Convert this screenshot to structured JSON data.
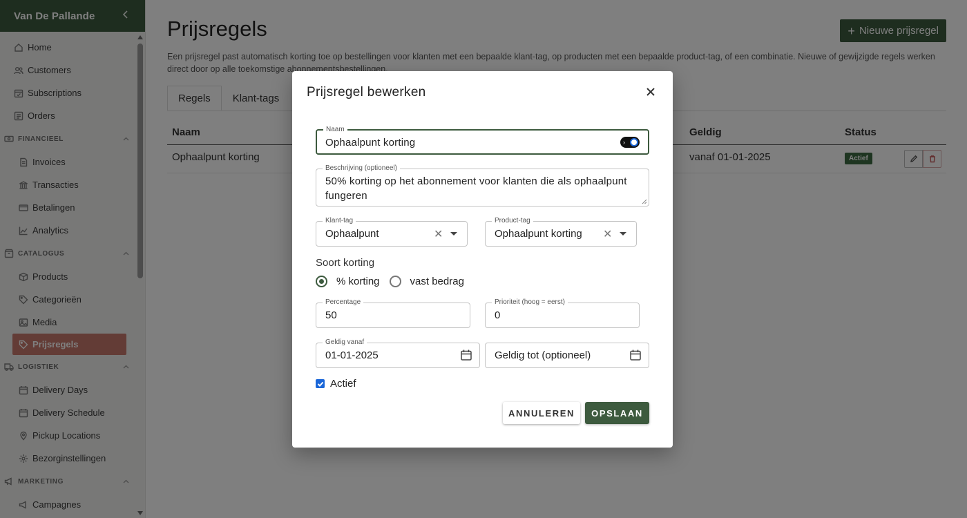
{
  "sidebar": {
    "brand": "Van De Pallande",
    "items_top": [
      {
        "label": "Home",
        "icon": "home-icon"
      },
      {
        "label": "Customers",
        "icon": "users-icon"
      },
      {
        "label": "Subscriptions",
        "icon": "calendar-check-icon"
      },
      {
        "label": "Orders",
        "icon": "list-icon"
      }
    ],
    "sections": [
      {
        "title": "FINANCIEEL",
        "icon": "money-icon",
        "items": [
          {
            "label": "Invoices",
            "icon": "document-icon"
          },
          {
            "label": "Transacties",
            "icon": "bank-icon"
          },
          {
            "label": "Betalingen",
            "icon": "credit-card-icon"
          },
          {
            "label": "Analytics",
            "icon": "chart-line-icon"
          }
        ]
      },
      {
        "title": "CATALOGUS",
        "icon": "box-icon",
        "items": [
          {
            "label": "Products",
            "icon": "cube-icon"
          },
          {
            "label": "Categorieën",
            "icon": "tag-icon"
          },
          {
            "label": "Media",
            "icon": "image-icon"
          },
          {
            "label": "Prijsregels",
            "icon": "tag-icon",
            "active": true
          }
        ]
      },
      {
        "title": "LOGISTIEK",
        "icon": "truck-icon",
        "items": [
          {
            "label": "Delivery Days",
            "icon": "calendar-icon"
          },
          {
            "label": "Delivery Schedule",
            "icon": "calendar-icon"
          },
          {
            "label": "Pickup Locations",
            "icon": "map-pin-icon"
          },
          {
            "label": "Bezorginstellingen",
            "icon": "gear-icon"
          }
        ]
      },
      {
        "title": "MARKETING",
        "icon": "megaphone-icon",
        "items": [
          {
            "label": "Campagnes",
            "icon": "megaphone-icon"
          }
        ]
      }
    ]
  },
  "page": {
    "title": "Prijsregels",
    "new_button": "Nieuwe prijsregel",
    "description": "Een prijsregel past automatisch korting toe op bestellingen voor klanten met een bepaalde klant-tag, op producten met een bepaalde product-tag, of een combinatie. Nieuwe of gewijzigde regels werken direct door op alle toekomstige abonnementsbestellingen.",
    "tabs": [
      "Regels",
      "Klant-tags"
    ],
    "table": {
      "columns": {
        "name": "Naam",
        "valid": "Geldig",
        "status": "Status"
      },
      "rows": [
        {
          "name": "Ophaalpunt korting",
          "valid": "vanaf 01-01-2025",
          "status": "Actief"
        }
      ]
    }
  },
  "dialog": {
    "title": "Prijsregel bewerken",
    "name_label": "Naam",
    "name_value": "Ophaalpunt korting",
    "desc_label": "Beschrijving (optioneel)",
    "desc_value": "50% korting op het abonnement voor klanten die als ophaalpunt fungeren",
    "klant_tag_label": "Klant-tag",
    "klant_tag_value": "Ophaalpunt",
    "product_tag_label": "Product-tag",
    "product_tag_value": "Ophaalpunt korting",
    "soort_label": "Soort korting",
    "radio_percent": "% korting",
    "radio_fixed": "vast bedrag",
    "selected_discount_type": "percent",
    "percentage_label": "Percentage",
    "percentage_value": "50",
    "priority_label": "Prioriteit (hoog = eerst)",
    "priority_value": "0",
    "valid_from_label": "Geldig vanaf",
    "valid_from_value": "01-01-2025",
    "valid_to_placeholder": "Geldig tot (optioneel)",
    "active_label": "Actief",
    "active_checked": true,
    "cancel": "ANNULEREN",
    "save": "OPSLAAN"
  },
  "colors": {
    "brand_green": "#3d5a3e",
    "active_nav": "#c7786d",
    "status_badge": "#3d6b42",
    "checkbox_blue": "#1a66d8"
  }
}
